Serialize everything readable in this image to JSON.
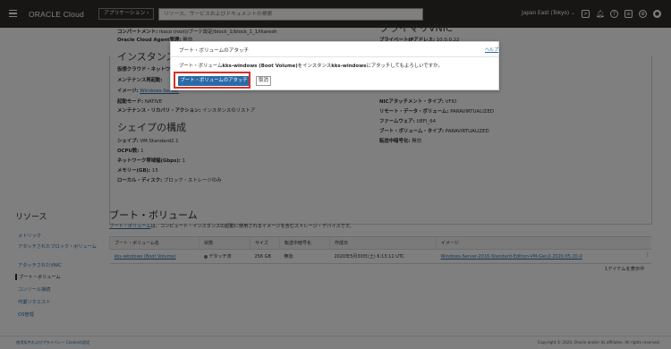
{
  "topbar": {
    "logo": "ORACLE Cloud",
    "apps_label": "アプリケーション",
    "search_placeholder": "リソース、サービスおよびドキュメントの検索",
    "region": "Japan East (Tokyo)",
    "icons": [
      "hamburger-icon",
      "cloud-shell-icon",
      "bell-icon",
      "help-icon",
      "chat-icon",
      "globe-icon",
      "user-icon"
    ]
  },
  "details": {
    "compartment_label": "コンパートメント:",
    "compartment_value": "ikaco (root)/ブーテ設定/block_1/block_1_1/Ikaresh",
    "agent_label": "Oracle Cloud Agent管理:",
    "agent_value": "無効",
    "instance_title": "インスタンスの",
    "vcn_label": "仮想クラウド・ネットワーク:",
    "maint_label": "メンテナンス再起動:",
    "image_label": "イメージ:",
    "image_value": "Windows-Server",
    "boot_mode_label": "起動モード:",
    "boot_mode_value": "NATIVE",
    "maint_action_label": "メンテナンス・リカバリ・アクション:",
    "maint_action_value": "インスタンスのリストア",
    "shape_title": "シェイプの構成",
    "shape_label": "シェイプ:",
    "shape_value": "VM.Standard2.1",
    "ocpu_label": "OCPU数:",
    "ocpu_value": "1",
    "net_label": "ネットワーク帯域幅(Gbps):",
    "net_value": "1",
    "mem_label": "メモリー(GB):",
    "mem_value": "15",
    "disk_label": "ローカル・ディスク:",
    "disk_value": "ブロック・ストレージのみ",
    "vnic_title": "プライマリVNIC",
    "private_ip_label": "プライベートIPアドレス:",
    "private_ip_value": "10.0.0.22",
    "nic_type_label": "NICアタッチメント・タイプ:",
    "nic_type_value": "VFIO",
    "remote_label": "リモート・データ・ボリューム:",
    "remote_value": "PARAVIRTUALIZED",
    "firmware_label": "ファームウェア:",
    "firmware_value": "UEFI_64",
    "boot_type_label": "ブート・ボリューム・タイプ:",
    "boot_type_value": "PARAVIRTUALIZED",
    "encrypt_label": "転送中暗号化:",
    "encrypt_value": "無効"
  },
  "sidebar": {
    "title": "リソース",
    "items": [
      {
        "label": "メトリック"
      },
      {
        "label": "アタッチされたブロック・ボリューム"
      },
      {
        "label": "アタッチされたVNIC"
      },
      {
        "label": "ブート・ボリューム"
      },
      {
        "label": "コンソール接続"
      },
      {
        "label": "作業リクエスト"
      },
      {
        "label": "OS管理"
      }
    ]
  },
  "main": {
    "title": "ブート・ボリューム",
    "desc_link": "ブート・ボリューム",
    "desc_rest": "は、コンピュート・インスタンスの起動に使用されるイメージを含むストレージ・デバイスです。",
    "columns": [
      "ブート・ボリューム名",
      "状態",
      "サイズ",
      "転送中暗号化",
      "作成日",
      "イメージ"
    ],
    "rows": [
      {
        "name": "kks-windows (Boot Volume)",
        "state": "デタッチ済",
        "size": "256 GB",
        "encryption": "無効",
        "created": "2020年5月30日(土) 6:13:11 UTC",
        "image": "Windows-Server-2016-Standard-Edition-VM-Gen2-2020.05.20-0"
      }
    ],
    "showing": "1アイテムを表示中"
  },
  "footer": {
    "links": "使用条件およびプライバシー    Cookieの設定",
    "copyright": "Copyright © 2020, Oracle and/or its affiliates. All rights reserved."
  },
  "dialog": {
    "title": "ブート・ボリュームのアタッチ",
    "help": "ヘルプ",
    "msg_pre": "ブート・ボリューム",
    "msg_vol": "kks-windows (Boot Volume)",
    "msg_mid": "をインスタンス",
    "msg_inst": "kks-windows",
    "msg_post": "にアタッチしてもよろしいですか。",
    "confirm_label": "ブート・ボリュームのアタッチ",
    "cancel_label": "取消"
  },
  "colors": {
    "topbar": "#312d2a",
    "primary_button": "#2a6aa8",
    "highlight": "#d6302a",
    "link": "#2d6ca2"
  }
}
